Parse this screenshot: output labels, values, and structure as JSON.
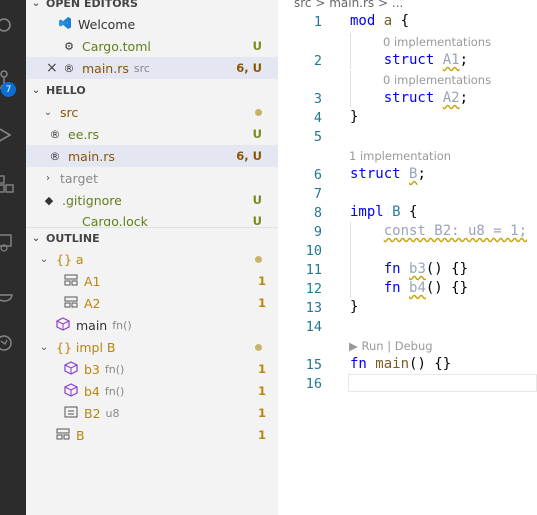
{
  "sidebar": {
    "open_editors": {
      "title": "OPEN EDITORS",
      "items": [
        {
          "label": "Welcome",
          "sub": "",
          "status": "",
          "icon": "vscode-icon"
        },
        {
          "label": "Cargo.toml",
          "sub": "",
          "status": "U",
          "icon": "gear-icon"
        },
        {
          "label": "main.rs",
          "sub": "src",
          "status": "6, U",
          "icon": "rust-icon"
        }
      ]
    },
    "explorer": {
      "title": "HELLO",
      "items": [
        {
          "label": "src",
          "status": "dot"
        },
        {
          "label": "ee.rs",
          "status": "U"
        },
        {
          "label": "main.rs",
          "status": "6, U"
        },
        {
          "label": "target",
          "status": ""
        },
        {
          "label": ".gitignore",
          "status": "U"
        },
        {
          "label": "Cargo.lock",
          "status": "U"
        }
      ]
    },
    "outline": {
      "title": "OUTLINE",
      "items": [
        {
          "label": "{} a",
          "detail": "",
          "count": "dot"
        },
        {
          "label": "A1",
          "detail": "",
          "count": "1"
        },
        {
          "label": "A2",
          "detail": "",
          "count": "1"
        },
        {
          "label": "main",
          "detail": "fn()",
          "count": ""
        },
        {
          "label": "{} impl B",
          "detail": "",
          "count": "dot"
        },
        {
          "label": "b3",
          "detail": "fn()",
          "count": "1"
        },
        {
          "label": "b4",
          "detail": "fn()",
          "count": "1"
        },
        {
          "label": "B2",
          "detail": "u8",
          "count": "1"
        },
        {
          "label": "B",
          "detail": "",
          "count": "1"
        }
      ]
    }
  },
  "activity_bar": {
    "badge": "7"
  },
  "editor": {
    "breadcrumb": "src  >  main.rs  >  ...",
    "lenses": {
      "impl0_a": "0 implementations",
      "impl0_b": "0 implementations",
      "impl1": "1 implementation",
      "run": "▶ Run | Debug"
    },
    "line_numbers": [
      "1",
      "2",
      "3",
      "4",
      "5",
      "6",
      "7",
      "8",
      "9",
      "10",
      "11",
      "12",
      "13",
      "14",
      "15",
      "16"
    ]
  },
  "colors": {
    "accent": "#0a6fd3",
    "untracked": "#5f7f1a",
    "modified": "#895503"
  }
}
